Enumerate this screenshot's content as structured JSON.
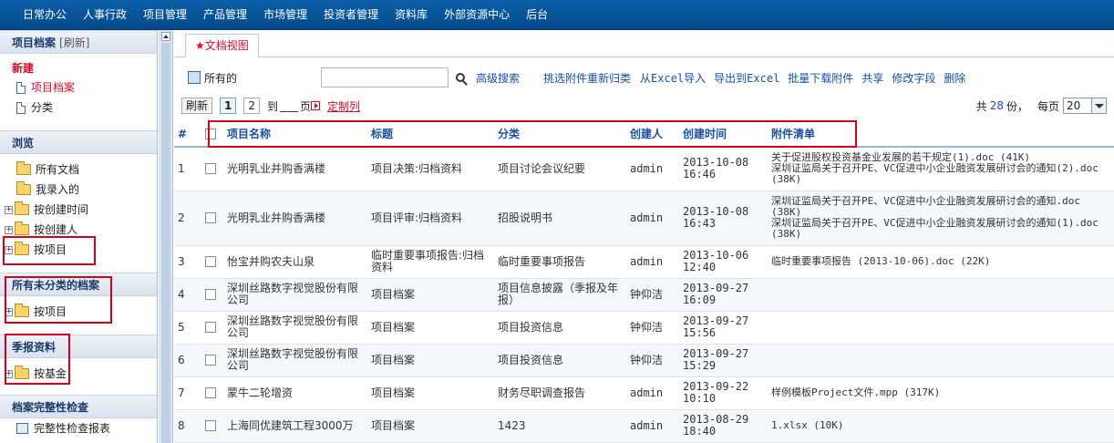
{
  "topnav": {
    "items": [
      "日常办公",
      "人事行政",
      "项目管理",
      "产品管理",
      "市场管理",
      "投资者管理",
      "资料库",
      "外部资源中心",
      "后台"
    ]
  },
  "sidebar": {
    "header": "项目档案",
    "refresh": "[刷新]",
    "new_label": "新建",
    "new_items": [
      "项目档案",
      "分类"
    ],
    "browse_header": "浏览",
    "browse_items": [
      "所有文档",
      "我录入的",
      "按创建时间",
      "按创建人",
      "按项目"
    ],
    "uncat_header": "所有未分类的档案",
    "uncat_items": [
      "按项目"
    ],
    "quarterly_header": "季报资料",
    "quarterly_items": [
      "按基金"
    ],
    "integrity_header": "档案完整性检查",
    "integrity_items": [
      "完整性检查报表"
    ]
  },
  "tab": {
    "label": "★文档视图"
  },
  "toolbar": {
    "scope": "所有的",
    "search_placeholder": "",
    "links": [
      "高级搜索",
      "挑选附件重新归类",
      "从Excel导入",
      "导出到Excel",
      "批量下载附件",
      "共享",
      "修改字段",
      "删除"
    ]
  },
  "pager": {
    "refresh": "刷新",
    "pages": [
      "1",
      "2"
    ],
    "to": "到",
    "page": "页",
    "custom_columns": "定制列",
    "total_prefix": "共",
    "total_count": "28",
    "total_suffix": "份，",
    "per_page_label": "每页",
    "per_page_value": "20"
  },
  "table": {
    "columns": [
      "#",
      "",
      "项目名称",
      "标题",
      "分类",
      "创建人",
      "创建时间",
      "附件清单"
    ],
    "rows": [
      {
        "num": "1",
        "name": "光明乳业并购香满楼",
        "title": "项目决策:归档资料",
        "category": "项目讨论会议纪要",
        "creator": "admin",
        "created": "2013-10-08\n16:46",
        "attachments": "关于促进股权投资基金业发展的若干规定(1).doc (41K)\n深圳证监局关于召开PE、VC促进中小企业融资发展研讨会的通知(2).doc (38K)"
      },
      {
        "num": "2",
        "name": "光明乳业并购香满楼",
        "title": "项目评审:归档资料",
        "category": "招股说明书",
        "creator": "admin",
        "created": "2013-10-08\n16:43",
        "attachments": "深圳证监局关于召开PE、VC促进中小企业融资发展研讨会的通知.doc (38K)\n深圳证监局关于召开PE、VC促进中小企业融资发展研讨会的通知(1).doc (38K)"
      },
      {
        "num": "3",
        "name": "怡宝并购农夫山泉",
        "title": "临时重要事项报告:归档资料",
        "category": "临时重要事项报告",
        "creator": "admin",
        "created": "2013-10-06\n12:40",
        "attachments": "临时重要事项报告 (2013-10-06).doc (22K)"
      },
      {
        "num": "4",
        "name": "深圳丝路数字视觉股份有限公司",
        "title": "项目档案",
        "category": "项目信息披露（季报及年报）",
        "creator": "钟仰洁",
        "created": "2013-09-27\n16:09",
        "attachments": ""
      },
      {
        "num": "5",
        "name": "深圳丝路数字视觉股份有限公司",
        "title": "项目档案",
        "category": "项目投资信息",
        "creator": "钟仰洁",
        "created": "2013-09-27\n15:56",
        "attachments": ""
      },
      {
        "num": "6",
        "name": "深圳丝路数字视觉股份有限公司",
        "title": "项目档案",
        "category": "项目投资信息",
        "creator": "钟仰洁",
        "created": "2013-09-27\n15:29",
        "attachments": ""
      },
      {
        "num": "7",
        "name": "蒙牛二轮增资",
        "title": "项目档案",
        "category": "财务尽职调查报告",
        "creator": "admin",
        "created": "2013-09-22\n10:10",
        "attachments": "样例模板Project文件.mpp (317K)"
      },
      {
        "num": "8",
        "name": "上海同优建筑工程3000万",
        "title": "项目档案",
        "category": "1423",
        "creator": "admin",
        "created": "2013-08-29\n18:40",
        "attachments": "1.xlsx (10K)"
      }
    ]
  }
}
